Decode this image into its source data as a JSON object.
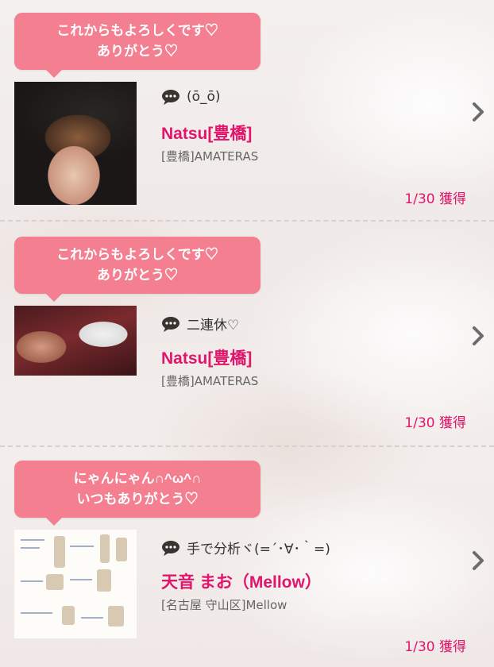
{
  "items": [
    {
      "bubble_line1": "これからもよろしくです♡",
      "bubble_line2": "ありがとう♡",
      "message": "(ō_ō)",
      "name": "Natsu[豊橋]",
      "shop": "[豊橋]AMATERAS",
      "date": "1/30 獲得"
    },
    {
      "bubble_line1": "これからもよろしくです♡",
      "bubble_line2": "ありがとう♡",
      "message": "二連休♡",
      "name": "Natsu[豊橋]",
      "shop": "[豊橋]AMATERAS",
      "date": "1/30 獲得"
    },
    {
      "bubble_line1": "にゃんにゃん∩^ω^∩",
      "bubble_line2": "いつもありがとう♡",
      "message": "手で分析ヾ(=´･∀･｀=)",
      "name": "天音 まお（Mellow）",
      "shop": "[名古屋 守山区]Mellow",
      "date": "1/30 獲得"
    }
  ],
  "icons": {
    "message": "speech-bubble-icon",
    "chevron": "chevron-right-icon"
  },
  "colors": {
    "bubble": "#f47f91",
    "accent": "#e0156b"
  }
}
